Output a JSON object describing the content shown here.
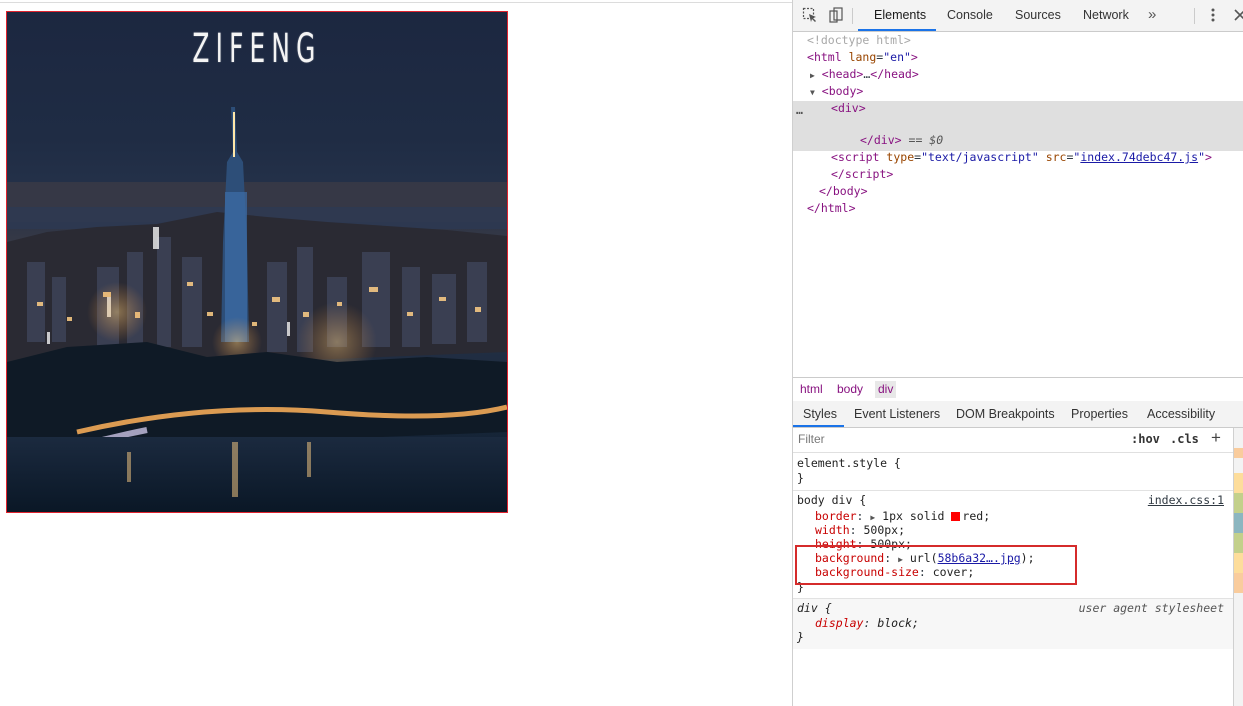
{
  "page": {
    "photo_title": "ZIFENG"
  },
  "devtools": {
    "tabs": [
      "Elements",
      "Console",
      "Sources",
      "Network"
    ],
    "more_tabs_glyph": "»",
    "dom": {
      "doctype": "<!doctype html>",
      "html_open_tag": "html",
      "html_lang_attr": "lang",
      "html_lang_val": "\"en\"",
      "head_tag": "head",
      "head_ellipsis": "…",
      "body_tag": "body",
      "div_tag": "div",
      "selected_marker": "== $0",
      "script_tag": "script",
      "script_type_attr": "type",
      "script_type_val": "\"text/javascript\"",
      "script_src_attr": "src",
      "script_src_val": "index.74debc47.js",
      "ellipsis_gutter": "…"
    },
    "breadcrumbs": [
      "html",
      "body",
      "div"
    ],
    "subtabs": [
      "Styles",
      "Event Listeners",
      "DOM Breakpoints",
      "Properties",
      "Accessibility"
    ],
    "filter_placeholder": "Filter",
    "hov_label": ":hov",
    "cls_label": ".cls",
    "add_rule_label": "+",
    "styles": {
      "element_style_selector": "element.style {",
      "close_brace": "}",
      "rule1_selector": "body div {",
      "rule1_source": "index.css:1",
      "rule1_props": [
        {
          "name": "border",
          "value": "1px solid",
          "swatch_value": "red;"
        },
        {
          "name": "width",
          "value": "500px;"
        },
        {
          "name": "height",
          "value": "500px;"
        },
        {
          "name": "background",
          "value_prefix": "url(",
          "link": "58b6a32….jpg",
          "value_suffix": ");"
        },
        {
          "name": "background-size",
          "value": "cover;"
        }
      ],
      "rule2_selector": "div {",
      "rule2_source": "user agent stylesheet",
      "rule2_prop_name": "display",
      "rule2_prop_value": "block;"
    }
  },
  "colors": {
    "accent_blue": "#1a73e8",
    "border_red": "#e0232e",
    "tag_purple": "#881280",
    "attr_brown": "#994500",
    "value_blue": "#1a1aa6",
    "prop_red": "#c80000"
  },
  "icons": [
    "inspect-element-icon",
    "device-toolbar-icon",
    "more-tabs-icon",
    "kebab-menu-icon",
    "close-icon",
    "expand-triangle-icon",
    "collapse-triangle-icon"
  ]
}
